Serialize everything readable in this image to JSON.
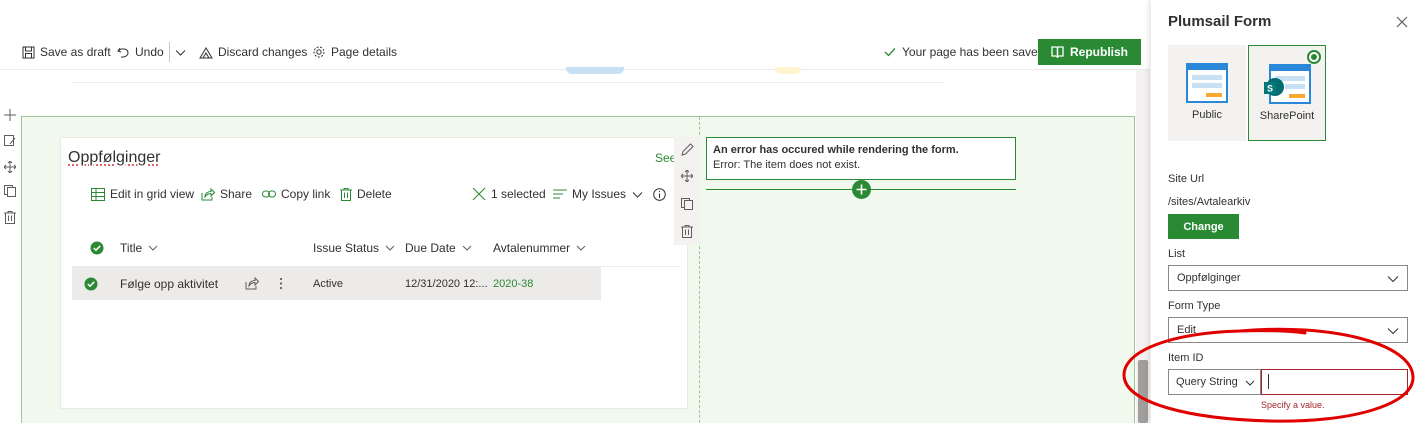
{
  "command_bar": {
    "save_draft": "Save as draft",
    "undo": "Undo",
    "discard": "Discard changes",
    "page_details": "Page details",
    "saved_status": "Your page has been saved",
    "republish": "Republish"
  },
  "list_webpart": {
    "title": "Oppfølginger",
    "see_all": "See",
    "commands": {
      "grid_view": "Edit in grid view",
      "share": "Share",
      "copy_link": "Copy link",
      "delete": "Delete",
      "selected": "1 selected",
      "view": "My Issues"
    },
    "columns": [
      "Title",
      "Issue Status",
      "Due Date",
      "Avtalenummer"
    ],
    "rows": [
      {
        "title": "Følge opp aktivitet",
        "status": "Active",
        "due": "12/31/2020 12:...",
        "avtale": "2020-38"
      }
    ]
  },
  "error": {
    "title": "An error has occured while rendering the form.",
    "message": "Error: The item does not exist."
  },
  "panel": {
    "title": "Plumsail Form",
    "tiles": [
      {
        "label": "Public",
        "selected": false
      },
      {
        "label": "SharePoint",
        "selected": true
      }
    ],
    "site_url_label": "Site Url",
    "site_url_value": "/sites/Avtalearkiv",
    "change_button": "Change",
    "list_label": "List",
    "list_value": "Oppfølginger",
    "form_type_label": "Form Type",
    "form_type_value": "Edit",
    "item_id_label": "Item ID",
    "item_id_source": "Query String",
    "item_id_value": "",
    "item_id_error": "Specify a value."
  },
  "colors": {
    "accent": "#2a8a33",
    "error": "#a4262c",
    "annotation": "#e00000"
  }
}
